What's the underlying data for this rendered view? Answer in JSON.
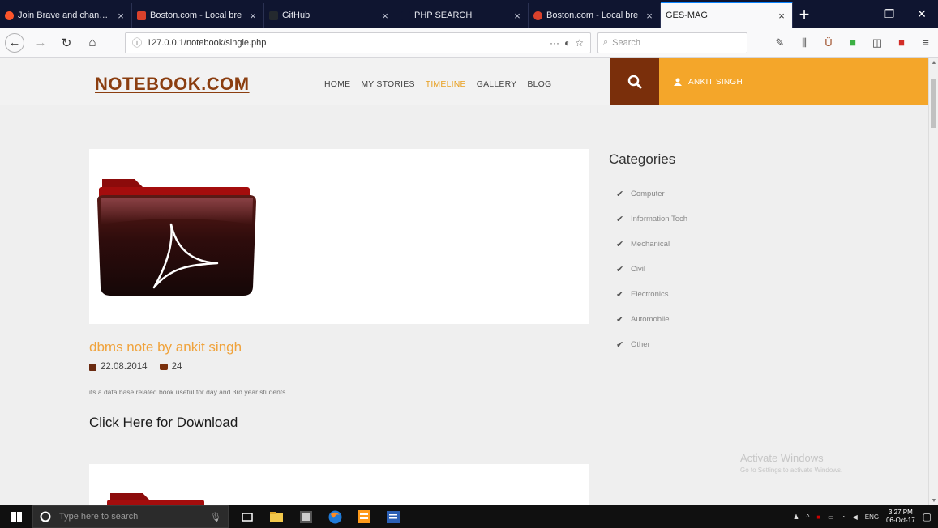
{
  "browser": {
    "tabs": [
      {
        "label": "Join Brave and change th",
        "icon_color": "#fb542b",
        "active": false
      },
      {
        "label": "Boston.com - Local bre",
        "icon_color": "#d9412c",
        "active": false
      },
      {
        "label": "GitHub",
        "icon_color": "#24292e",
        "active": false
      },
      {
        "label": "PHP SEARCH",
        "icon_color": "#0f1530",
        "active": false
      },
      {
        "label": "Boston.com - Local bre",
        "icon_color": "#d9412c",
        "active": false
      },
      {
        "label": "GES-MAG",
        "icon_color": "#ffffff",
        "active": true
      }
    ],
    "new_tab": "+",
    "url": "127.0.0.1/notebook/single.php",
    "search_placeholder": "Search",
    "page_actions": "···"
  },
  "site": {
    "logo": "NOTEBOOK.COM",
    "menu": [
      {
        "label": "HOME",
        "active": false
      },
      {
        "label": "MY STORIES",
        "active": false
      },
      {
        "label": "TIMELINE",
        "active": true
      },
      {
        "label": "GALLERY",
        "active": false
      },
      {
        "label": "BLOG",
        "active": false
      }
    ],
    "user_name": "ANKIT SINGH",
    "colors": {
      "brand": "#8b3e10",
      "accent": "#f4a62a",
      "dark_accent": "#7a2f0b"
    }
  },
  "post": {
    "title": "dbms note by ankit singh",
    "date": "22.08.2014",
    "comments": "24",
    "description": "its a data base related book useful for day and 3rd year students",
    "download_label": "Click Here for Download"
  },
  "sidebar": {
    "heading": "Categories",
    "categories": [
      "Computer",
      "Information Tech",
      "Mechanical",
      "Civil",
      "Electronics",
      "Automobile",
      "Other"
    ]
  },
  "watermark": {
    "line1": "Activate Windows",
    "line2": "Go to Settings to activate Windows."
  },
  "taskbar": {
    "search_placeholder": "Type here to search",
    "language": "ENG",
    "time": "3:27 PM",
    "date": "06-Oct-17"
  }
}
